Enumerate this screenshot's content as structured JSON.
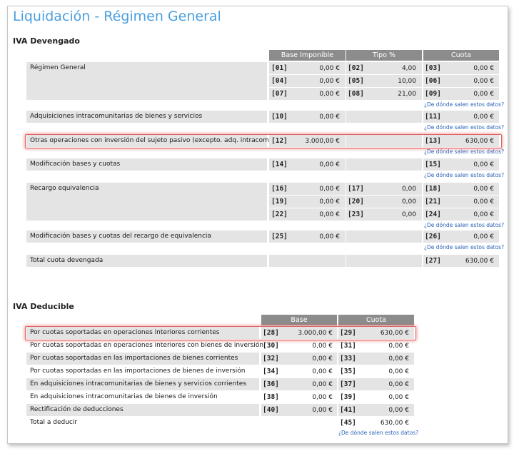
{
  "title": "Liquidación - Régimen General",
  "devengado": {
    "section_title": "IVA Devengado",
    "headers": [
      "Base Imponible",
      "Tipo %",
      "Cuota"
    ],
    "link_text": "¿De dónde salen estos datos?",
    "rows": [
      {
        "label": "Régimen General",
        "lines": [
          {
            "c1": "[01]",
            "v1": "0,00 €",
            "c2": "[02]",
            "v2": "4,00",
            "c3": "[03]",
            "v3": "0,00 €"
          },
          {
            "c1": "[04]",
            "v1": "0,00 €",
            "c2": "[05]",
            "v2": "10,00",
            "c3": "[06]",
            "v3": "0,00 €"
          },
          {
            "c1": "[07]",
            "v1": "0,00 €",
            "c2": "[08]",
            "v2": "21,00",
            "c3": "[09]",
            "v3": "0,00 €"
          }
        ]
      },
      {
        "label": "Adquisiciones intracomunitarias de bienes y servicios",
        "lines": [
          {
            "c1": "[10]",
            "v1": "0,00 €",
            "c2": "",
            "v2": "",
            "c3": "[11]",
            "v3": "0,00 €"
          }
        ]
      },
      {
        "label": "Otras operaciones con inversión del sujeto pasivo (excepto. adq. intracom)",
        "lines": [
          {
            "c1": "[12]",
            "v1": "3.000,00 €",
            "c2": "",
            "v2": "",
            "c3": "[13]",
            "v3": "630,00 €"
          }
        ]
      },
      {
        "label": "Modificación bases y cuotas",
        "lines": [
          {
            "c1": "[14]",
            "v1": "0,00 €",
            "c2": "",
            "v2": "",
            "c3": "[15]",
            "v3": "0,00 €"
          }
        ]
      },
      {
        "label": "Recargo equivalencia",
        "lines": [
          {
            "c1": "[16]",
            "v1": "0,00 €",
            "c2": "[17]",
            "v2": "0,00",
            "c3": "[18]",
            "v3": "0,00 €"
          },
          {
            "c1": "[19]",
            "v1": "0,00 €",
            "c2": "[20]",
            "v2": "0,00",
            "c3": "[21]",
            "v3": "0,00 €"
          },
          {
            "c1": "[22]",
            "v1": "0,00 €",
            "c2": "[23]",
            "v2": "0,00",
            "c3": "[24]",
            "v3": "0,00 €"
          }
        ]
      },
      {
        "label": "Modificación bases y cuotas del recargo de equivalencia",
        "lines": [
          {
            "c1": "[25]",
            "v1": "0,00 €",
            "c2": "",
            "v2": "",
            "c3": "[26]",
            "v3": "0,00 €"
          }
        ]
      },
      {
        "label": "Total cuota devengada",
        "lines": [
          {
            "c1": "",
            "v1": "",
            "c2": "",
            "v2": "",
            "c3": "[27]",
            "v3": "630,00 €"
          }
        ]
      }
    ]
  },
  "deducible": {
    "section_title": "IVA Deducible",
    "headers": [
      "Base",
      "Cuota"
    ],
    "link_text": "¿De dónde salen estos datos?",
    "rows": [
      {
        "label": "Por cuotas soportadas en operaciones interiores corrientes",
        "c1": "[28]",
        "v1": "3.000,00 €",
        "c2": "[29]",
        "v2": "630,00 €"
      },
      {
        "label": "Por cuotas soportadas en operaciones interiores con bienes de inversión",
        "c1": "[30]",
        "v1": "0,00 €",
        "c2": "[31]",
        "v2": "0,00 €"
      },
      {
        "label": "Por cuotas soportadas en las importaciones de bienes corrientes",
        "c1": "[32]",
        "v1": "0,00 €",
        "c2": "[33]",
        "v2": "0,00 €"
      },
      {
        "label": "Por cuotas soportadas en las importaciones de bienes de inversión",
        "c1": "[34]",
        "v1": "0,00 €",
        "c2": "[35]",
        "v2": "0,00 €"
      },
      {
        "label": "En adquisiciones intracomunitarias de bienes y servicios corrientes",
        "c1": "[36]",
        "v1": "0,00 €",
        "c2": "[37]",
        "v2": "0,00 €"
      },
      {
        "label": "En adquisiciones intracomunitarias de bienes de inversión",
        "c1": "[38]",
        "v1": "0,00 €",
        "c2": "[39]",
        "v2": "0,00 €"
      },
      {
        "label": "Rectificación de deducciones",
        "c1": "[40]",
        "v1": "0,00 €",
        "c2": "[41]",
        "v2": "0,00 €"
      },
      {
        "label": "Total a deducir",
        "c1": "",
        "v1": "",
        "c2": "[45]",
        "v2": "630,00 €"
      }
    ]
  },
  "colors": {
    "title": "#4a9ee0",
    "header": "#8c8c8c",
    "row": "#e4e4e4",
    "link": "#2a62b8",
    "highlight": "#e06060"
  }
}
